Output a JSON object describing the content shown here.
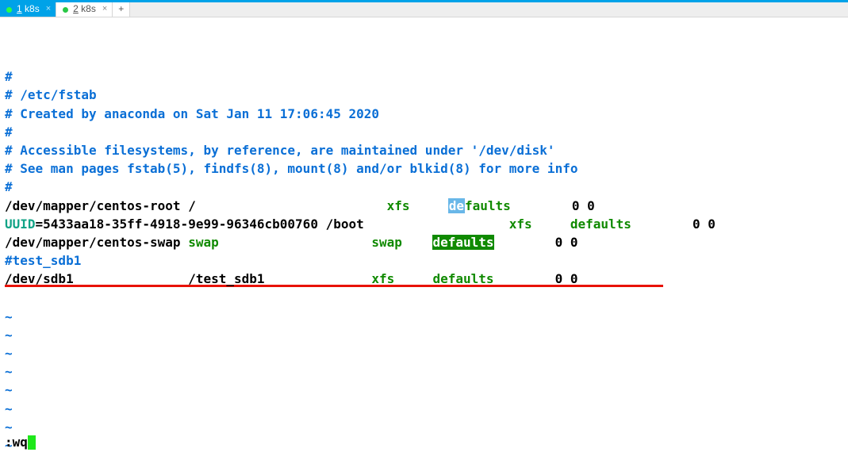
{
  "tabs": {
    "t0": {
      "label": "1 k8s"
    },
    "t1": {
      "label": "2 k8s"
    }
  },
  "file": {
    "l1": "#",
    "l2": "# /etc/fstab",
    "l3": "# Created by anaconda on Sat Jan 11 17:06:45 2020",
    "l4": "#",
    "l5": "# Accessible filesystems, by reference, are maintained under '/dev/disk'",
    "l6": "# See man pages fstab(5), findfs(8), mount(8) and/or blkid(8) for more info",
    "l7": "#",
    "r1": {
      "dev": "/dev/mapper/centos-root /",
      "fs": "xfs",
      "opt": "defaults",
      "dump": "0 0"
    },
    "r2": {
      "uuid_lbl": "UUID",
      "uuid_val": "=5433aa18-35ff-4918-9e99-96346cb00760 /boot",
      "fs": "xfs",
      "opt": "defaults",
      "dump": "0 0"
    },
    "r3": {
      "dev": "/dev/mapper/centos-swap ",
      "mnt": "swap",
      "fs": "swap",
      "opt": "defaults",
      "dump": "0 0"
    },
    "c1": "#test_sdb1",
    "r4": {
      "dev": "/dev/sdb1",
      "mnt": "/test_sdb1",
      "fs": "xfs",
      "opt": "defaults",
      "dump": "0 0"
    }
  },
  "vim": {
    "cmd": ":wq"
  },
  "glyphs": {
    "tilde": "~",
    "plus": "+",
    "close": "×"
  }
}
